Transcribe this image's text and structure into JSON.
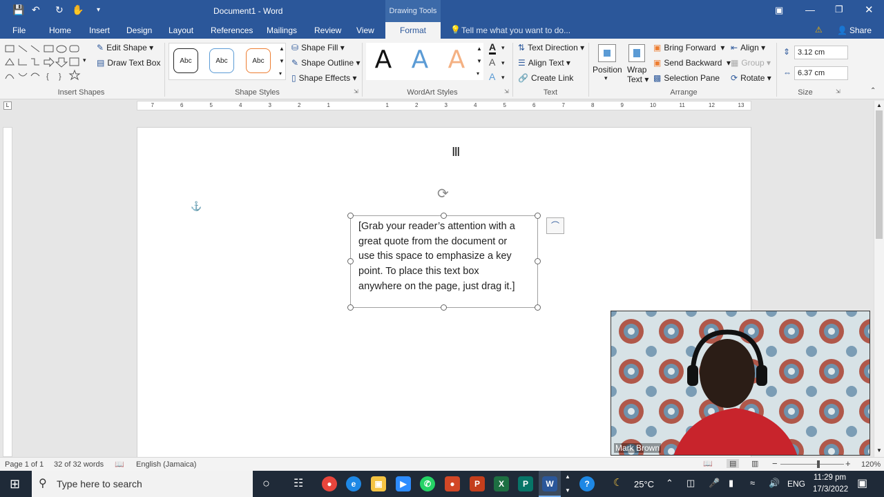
{
  "window": {
    "title": "Document1 - Word",
    "contextual_group": "Drawing Tools"
  },
  "tabs": [
    "File",
    "Home",
    "Insert",
    "Design",
    "Layout",
    "References",
    "Mailings",
    "Review",
    "View"
  ],
  "active_tab": "Format",
  "tell_me": "Tell me what you want to do...",
  "share": "Share",
  "ribbon": {
    "insert_shapes": {
      "label": "Insert Shapes",
      "edit_shape": "Edit Shape",
      "draw_text_box": "Draw Text Box"
    },
    "shape_styles": {
      "label": "Shape Styles",
      "presets": [
        "Abc",
        "Abc",
        "Abc"
      ],
      "fill": "Shape Fill",
      "outline": "Shape Outline",
      "effects": "Shape Effects"
    },
    "wordart": {
      "label": "WordArt Styles",
      "letters": [
        "A",
        "A",
        "A"
      ]
    },
    "text": {
      "label": "Text",
      "direction": "Text Direction",
      "align": "Align Text",
      "link": "Create Link"
    },
    "arrange": {
      "label": "Arrange",
      "position": "Position",
      "wrap_line1": "Wrap",
      "wrap_line2": "Text",
      "bring_forward": "Bring Forward",
      "send_backward": "Send Backward",
      "selection_pane": "Selection Pane",
      "align": "Align",
      "group": "Group",
      "rotate": "Rotate"
    },
    "size": {
      "label": "Size",
      "height": "3.12 cm",
      "width": "6.37 cm"
    }
  },
  "ruler_marks": [
    "7",
    "6",
    "5",
    "4",
    "3",
    "2",
    "1",
    "1",
    "2",
    "3",
    "4",
    "5",
    "6",
    "7",
    "8",
    "9",
    "10",
    "11",
    "12",
    "13"
  ],
  "document": {
    "textbox_lines": [
      "[Grab your reader’s attention with a",
      "great quote from the document or",
      "use this space to emphasize a key",
      "point. To place this text box",
      "anywhere on the page, just drag it.]"
    ]
  },
  "status": {
    "page": "Page 1 of 1",
    "words": "32 of 32 words",
    "language": "English (Jamaica)",
    "zoom": "120%",
    "zoom_level": 0.6
  },
  "webcam": {
    "name": "Mark Brown"
  },
  "taskbar": {
    "search_placeholder": "Type here to search",
    "temperature": "25°C",
    "lang": "ENG",
    "time": "11:29 pm",
    "date": "17/3/2022"
  },
  "colors": {
    "word_blue": "#2b579a",
    "taskbar": "#1f2a38"
  }
}
